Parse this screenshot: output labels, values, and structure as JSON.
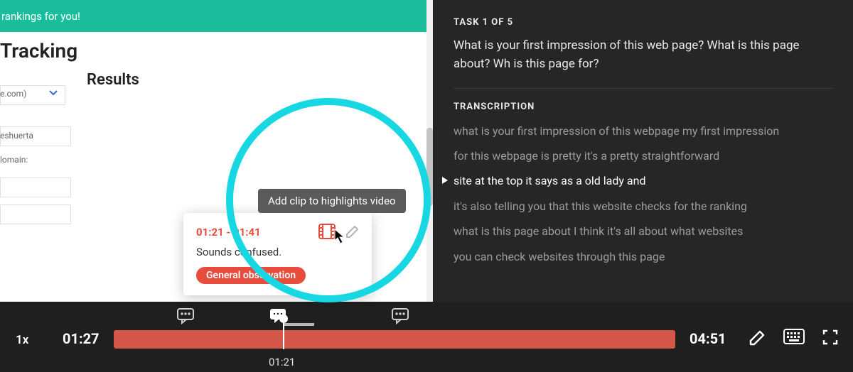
{
  "left": {
    "banner": "rankings for you!",
    "heading": "Tracking",
    "subheading": "Results",
    "field_a": "e.com)",
    "field_b": "eshuerta",
    "label_domain": "lomain:"
  },
  "task": {
    "counter": "TASK 1 OF 5",
    "question": "What is your first impression of this web page? What is this page about? Wh is this page for?"
  },
  "transcription": {
    "label": "TRANSCRIPTION",
    "lines": [
      "what is your first impression of this webpage my first impression",
      "for this webpage is pretty it's a pretty straightforward",
      "site at the top it says as a old lady and",
      "it's also telling you that this website checks for the ranking",
      "what is this page about I think it's all about what websites",
      "you can check websites through this page"
    ],
    "active_index": 2
  },
  "annotation": {
    "time_range": "01:21 - 01:41",
    "note": "Sounds confused.",
    "tag": "General observation",
    "tooltip": "Add clip to highlights video"
  },
  "player": {
    "speed": "1x",
    "current": "01:27",
    "duration": "04:51",
    "playhead_label": "01:21"
  }
}
